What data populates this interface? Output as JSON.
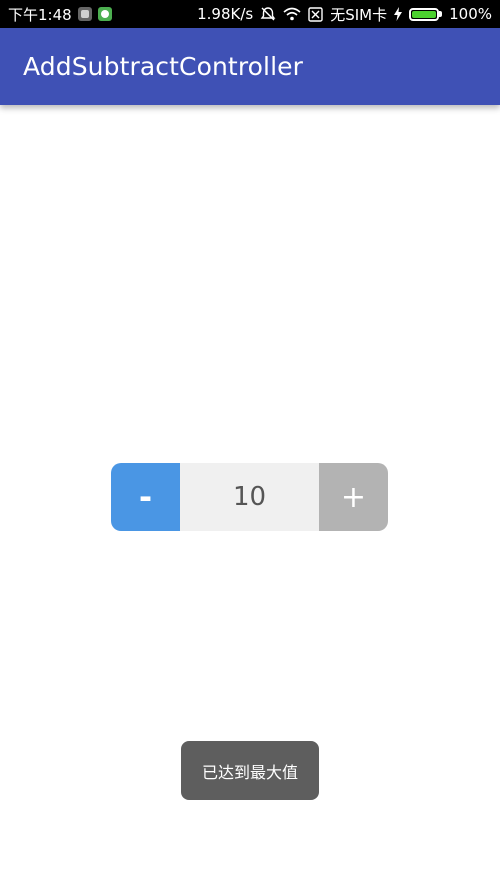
{
  "status_bar": {
    "time": "下午1:48",
    "network_speed": "1.98K/s",
    "carrier": "无SIM卡",
    "battery_percent": "100%",
    "battery_level": 1.0,
    "icons": [
      "photo-notification-icon",
      "android-notification-icon",
      "alarm-off-icon",
      "wifi-icon",
      "no-sim-icon",
      "charging-icon",
      "battery-icon"
    ]
  },
  "app_bar": {
    "title": "AddSubtractController",
    "color": "#3f51b5"
  },
  "controller": {
    "minus_label": "-",
    "value": "10",
    "plus_label": "+",
    "minus_color": "#4a96e4",
    "plus_color": "#b3b3b3",
    "value_bg": "#f0f0f0"
  },
  "toast": {
    "message": "已达到最大值"
  }
}
